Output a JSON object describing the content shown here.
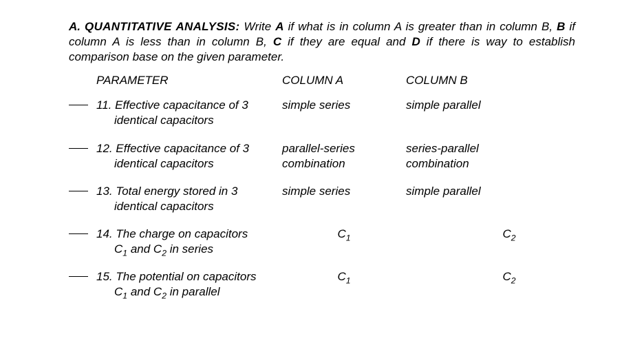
{
  "section": {
    "letter": "A.",
    "title": "QUANTITATIVE ANALYSIS:",
    "instructions_1": "Write ",
    "keyA": "A",
    "instr_2": " if what is in column A is greater than in column B, ",
    "keyB": "B",
    "instr_3": " if column A is less than in column B, ",
    "keyC": "C",
    "instr_4": " if they are equal and ",
    "keyD": "D",
    "instr_5": " if there is way to establish comparison base on the given parameter."
  },
  "headers": {
    "parameter": "PARAMETER",
    "colA": "COLUMN A",
    "colB": "COLUMN B"
  },
  "rows": [
    {
      "num": "11.",
      "param_l1": "Effective capacitance of 3",
      "param_l2": "identical capacitors",
      "colA": "simple series",
      "colB": "simple parallel"
    },
    {
      "num": "12.",
      "param_l1": "Effective capacitance of 3",
      "param_l2": "identical capacitors",
      "colA": "parallel-series combination",
      "colB": "series-parallel combination"
    },
    {
      "num": "13.",
      "param_l1": "Total energy stored in 3",
      "param_l2": "identical capacitors",
      "colA": "simple series",
      "colB": "simple parallel"
    },
    {
      "num": "14.",
      "param_l1": "The charge on capacitors",
      "param_l2_pre": "C",
      "param_l2_sub1": "1",
      "param_l2_mid": " and C",
      "param_l2_sub2": "2",
      "param_l2_post": " in series",
      "colA_pre": "C",
      "colA_sub": "1",
      "colB_pre": "C",
      "colB_sub": "2"
    },
    {
      "num": "15.",
      "param_l1": "The potential on capacitors",
      "param_l2_pre": "C",
      "param_l2_sub1": "1",
      "param_l2_mid": " and C",
      "param_l2_sub2": "2",
      "param_l2_post": " in parallel",
      "colA_pre": "C",
      "colA_sub": "1",
      "colB_pre": "C",
      "colB_sub": "2"
    }
  ]
}
